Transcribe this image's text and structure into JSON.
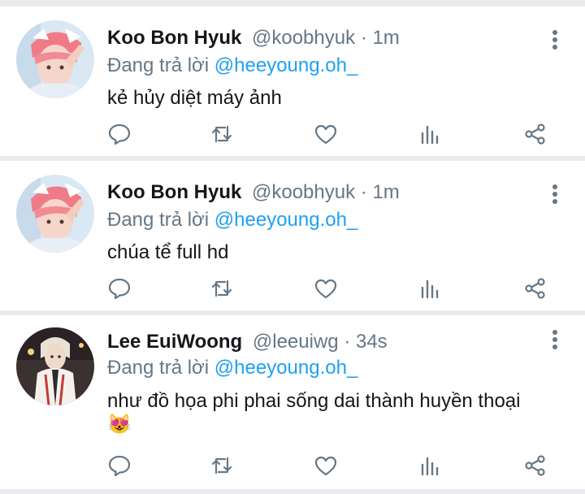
{
  "tweets": [
    {
      "name": "Koo Bon Hyuk",
      "handle": "@koobhyuk",
      "time": "1m",
      "reply_prefix": "Đang trả lời",
      "reply_mention": "@heeyoung.oh_",
      "text": "kẻ hủy diệt máy ảnh",
      "avatar_icon": "profile-photo-pink-hair"
    },
    {
      "name": "Koo Bon Hyuk",
      "handle": "@koobhyuk",
      "time": "1m",
      "reply_prefix": "Đang trả lời",
      "reply_mention": "@heeyoung.oh_",
      "text": "chúa tể full hd",
      "avatar_icon": "profile-photo-pink-hair"
    },
    {
      "name": "Lee EuiWoong",
      "handle": "@leeuiwg",
      "time": "34s",
      "reply_prefix": "Đang trả lời",
      "reply_mention": "@heeyoung.oh_",
      "text": "như đồ họa phi phai sống dai thành huyền thoại",
      "emoji": "😻",
      "avatar_icon": "profile-photo-night"
    }
  ],
  "separator": " · ",
  "action_icons": [
    "reply-icon",
    "retweet-icon",
    "like-icon",
    "analytics-icon",
    "share-icon"
  ],
  "colors": {
    "name": "#14171a",
    "secondary": "#657786",
    "mention": "#1da1f2",
    "divider": "#e9ecef"
  }
}
